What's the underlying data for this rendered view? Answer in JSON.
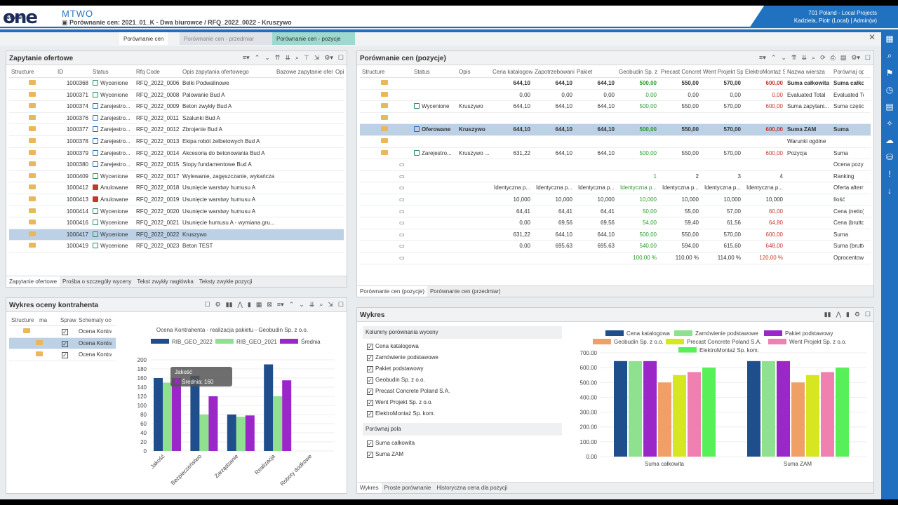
{
  "app": {
    "logo_text": "one",
    "logo_small": "software",
    "product": "MTWO",
    "breadcrumb": "Porównanie cen: 2021_01_K - Dwa biurowce / RFQ_2022_0022 - Kruszywo",
    "company": "701 Poland - Local Projects",
    "user": "Kadziela, Piotr (Local) | Admin(w)"
  },
  "tabs": [
    "Porównanie cen",
    "Porównanie cen - przedmiar",
    "Porównanie cen - pozycje"
  ],
  "rfq_panel": {
    "title": "Zapytanie ofertowe",
    "columns": [
      "Structure",
      "ID",
      "Status",
      "Rfq Code",
      "Opis zapytania ofertowego",
      "Bazowe zapytanie oferto",
      "Opis"
    ],
    "rows": [
      [
        "1000368",
        "Wycenione",
        "RFQ_2022_0006",
        "Belki Podwalinowe",
        "green"
      ],
      [
        "1000371",
        "Wycenione",
        "RFQ_2022_0008",
        "Palowanie Bud A",
        "green"
      ],
      [
        "1000374",
        "Zarejestro...",
        "RFQ_2022_0009",
        "Beton zwykły Bud A",
        "blue"
      ],
      [
        "1000376",
        "Zarejestro...",
        "RFQ_2022_0011",
        "Szalunki Bud A",
        "blue"
      ],
      [
        "1000377",
        "Zarejestro...",
        "RFQ_2022_0012",
        "Zbrojenie Bud A",
        "blue"
      ],
      [
        "1000378",
        "Zarejestro...",
        "RFQ_2022_0013",
        "Ekipa robót żelbetowych Bud A",
        "blue"
      ],
      [
        "1000379",
        "Zarejestro...",
        "RFQ_2022_0014",
        "Akcesoria do betonowania Bud A",
        "blue"
      ],
      [
        "1000380",
        "Zarejestro...",
        "RFQ_2022_0015",
        "Stopy fundamentowe Bud A",
        "blue"
      ],
      [
        "1000409",
        "Wycenione",
        "RFQ_2022_0017",
        "Wylewanie, zagęszczanie, wykańcza...",
        "green"
      ],
      [
        "1000412",
        "Anulowane",
        "RFQ_2022_0018",
        "Usunięcie warstwy humusu A",
        "red"
      ],
      [
        "1000413",
        "Anulowane",
        "RFQ_2022_0019",
        "Usunięcie warstwy humusu A",
        "red"
      ],
      [
        "1000414",
        "Wycenione",
        "RFQ_2022_0020",
        "Usunięcie warstwy humusu A",
        "green"
      ],
      [
        "1000416",
        "Wycenione",
        "RFQ_2022_0021",
        "Usunięcie humusu A - wymiana gru...",
        "green"
      ],
      [
        "1000417",
        "Wycenione",
        "RFQ_2022_0022",
        "Kruszywo",
        "green"
      ],
      [
        "1000419",
        "Wycenione",
        "RFQ_2022_0023",
        "Beton TEST",
        "green"
      ]
    ],
    "tabs": [
      "Zapytanie ofertowe",
      "Prośba o szczegóły wyceny",
      "Tekst zwykły nagłówka",
      "Teksty zwykłe pozycji"
    ]
  },
  "compare_panel": {
    "title": "Porównanie cen (pozycje)",
    "columns": [
      "Structure",
      "Status",
      "Opis",
      "Cena katalogowa",
      "Zapotrzebowanie",
      "Pakiet",
      "Geobudin Sp. z o.",
      "Precast Concrete",
      "Went Projekt Sp.",
      "ElektroMontaż Sp.",
      "Nazwa wiersza",
      "Porównaj opis"
    ],
    "rows": [
      [
        "",
        "",
        "",
        "644,10",
        "644,10",
        "644,10",
        "500,00",
        "550,00",
        "570,00",
        "600,00",
        "Suma całkowita",
        "Suma całkow"
      ],
      [
        "",
        "",
        "",
        "0,00",
        "0,00",
        "0,00",
        "0,00",
        "0,00",
        "0,00",
        "0,00",
        "Evaluated Total",
        "Evaluated To"
      ],
      [
        "",
        "Wycenione",
        "Kruszywo",
        "644,10",
        "644,10",
        "644,10",
        "500,00",
        "550,00",
        "570,00",
        "600,00",
        "Suma zapytani...",
        "Suma części"
      ],
      [
        "",
        "",
        "",
        "",
        "",
        "",
        "",
        "",
        "",
        "",
        "",
        ""
      ],
      [
        "",
        "Oferowane",
        "Kruszywo",
        "644,10",
        "644,10",
        "644,10",
        "500,00",
        "550,00",
        "570,00",
        "600,00",
        "Suma ZAM",
        "Suma"
      ],
      [
        "",
        "",
        "",
        "",
        "",
        "",
        "",
        "",
        "",
        "",
        "Warunki ogólne",
        ""
      ],
      [
        "",
        "Zarejestro...",
        "Kruszywo ...",
        "631,22",
        "644,10",
        "644,10",
        "500,00",
        "550,00",
        "570,00",
        "600,00",
        "Pozycja",
        "Suma"
      ],
      [
        "",
        "",
        "",
        "",
        "",
        "",
        "",
        "",
        "",
        "",
        "",
        "Ocena pozyc"
      ],
      [
        "",
        "",
        "",
        "",
        "",
        "",
        "1",
        "2",
        "3",
        "4",
        "",
        "Ranking"
      ],
      [
        "",
        "",
        "",
        "Identyczna p...",
        "Identyczna p...",
        "Identyczna p...",
        "Identyczna p...",
        "Identyczna p...",
        "Identyczna p...",
        "Identyczna p...",
        "",
        "Oferta altern"
      ],
      [
        "",
        "",
        "",
        "10,000",
        "10,000",
        "10,000",
        "10,000",
        "10,000",
        "10,000",
        "10,000",
        "",
        "Ilość"
      ],
      [
        "",
        "",
        "",
        "64,41",
        "64,41",
        "64,41",
        "50,00",
        "55,00",
        "57,00",
        "60,00",
        "",
        "Cena (netto)"
      ],
      [
        "",
        "",
        "",
        "0,00",
        "69,56",
        "69,56",
        "54,00",
        "59,40",
        "61,56",
        "64,80",
        "",
        "Cena (brutto"
      ],
      [
        "",
        "",
        "",
        "631,22",
        "644,10",
        "644,10",
        "500,00",
        "550,00",
        "570,00",
        "600,00",
        "",
        "Suma"
      ],
      [
        "",
        "",
        "",
        "0,00",
        "695,63",
        "695,63",
        "540,00",
        "594,00",
        "615,60",
        "648,00",
        "",
        "Suma (brutto"
      ],
      [
        "",
        "",
        "",
        "",
        "",
        "",
        "100,00 %",
        "110,00 %",
        "114,00 %",
        "120,00 %",
        "",
        "Oprocentow"
      ]
    ],
    "tabs": [
      "Porównanie cen (pozycje)",
      "Porównanie cen (przedmiar)"
    ]
  },
  "eval_panel": {
    "title": "Wykres oceny kontrahenta",
    "tree_cols": [
      "Structure",
      "ma",
      "Spraw",
      "Schematy oce"
    ],
    "tree_rows": [
      "Ocena Kontra",
      "Ocena Kontra",
      "Ocena Kontra"
    ]
  },
  "eval_chart": {
    "title": "Ocena Kontrahenta - realizacja pakietu - Geobudin Sp. z o.o.",
    "tooltip_title": "Jakość",
    "tooltip_value": "Średnia: 160"
  },
  "wykres_panel": {
    "title": "Wykres",
    "section1": "Kolumny porównania wyceny",
    "items1": [
      "Cena katalogowa",
      "Zamówienie podstawowe",
      "Pakiet podstawowy",
      "Geobudin Sp. z o.o.",
      "Precast Concrete Poland S.A.",
      "Went Projekt Sp. z o.o.",
      "ElektroMontaż Sp. kom."
    ],
    "section2": "Porównaj pola",
    "items2": [
      "Suma całkowita",
      "Suma ZAM"
    ],
    "tabs": [
      "Wykres",
      "Proste porównanie",
      "Historyczna cena dla pozycji"
    ]
  },
  "chart_data": [
    {
      "type": "bar",
      "title": "Ocena Kontrahenta - realizacja pakietu - Geobudin Sp. z o.o.",
      "categories": [
        "Jakość",
        "Bezpieczeństwo",
        "Zarządzanie",
        "Realizacja",
        "Roboty dodkowe"
      ],
      "series": [
        {
          "name": "RIB_GEO_2022",
          "color": "#1f4e8c",
          "values": [
            160,
            165,
            80,
            190,
            0
          ]
        },
        {
          "name": "RIB_GEO_2021",
          "color": "#8fe08f",
          "values": [
            150,
            80,
            75,
            120,
            0
          ]
        },
        {
          "name": "Średnia",
          "color": "#9b27c9",
          "values": [
            160,
            120,
            78,
            155,
            0
          ]
        }
      ],
      "ylim": [
        0,
        200
      ],
      "yticks": [
        0,
        20,
        40,
        60,
        80,
        100,
        120,
        140,
        160,
        180,
        200
      ]
    },
    {
      "type": "bar",
      "categories": [
        "Suma całkowita",
        "Suma ZAM"
      ],
      "series": [
        {
          "name": "Cena katalogowa",
          "color": "#1f4e8c",
          "values": [
            644.1,
            644.1
          ]
        },
        {
          "name": "Zamówienie podstawowe",
          "color": "#8fe08f",
          "values": [
            644.1,
            644.1
          ]
        },
        {
          "name": "Pakiet podstawowy",
          "color": "#9b27c9",
          "values": [
            644.1,
            644.1
          ]
        },
        {
          "name": "Geobudin Sp. z o.o.",
          "color": "#f0a066",
          "values": [
            500,
            500
          ]
        },
        {
          "name": "Precast Concrete Poland S.A.",
          "color": "#d6e620",
          "values": [
            550,
            550
          ]
        },
        {
          "name": "Went Projekt Sp. z o.o.",
          "color": "#f080b0",
          "values": [
            570,
            570
          ]
        },
        {
          "name": "ElektroMontaż Sp. kom.",
          "color": "#58f058",
          "values": [
            600,
            600
          ]
        }
      ],
      "ylim": [
        0,
        700
      ],
      "yticks": [
        "0.00",
        "100.00",
        "200.00",
        "300.00",
        "400.00",
        "500.00",
        "600.00",
        "700.00"
      ]
    }
  ]
}
